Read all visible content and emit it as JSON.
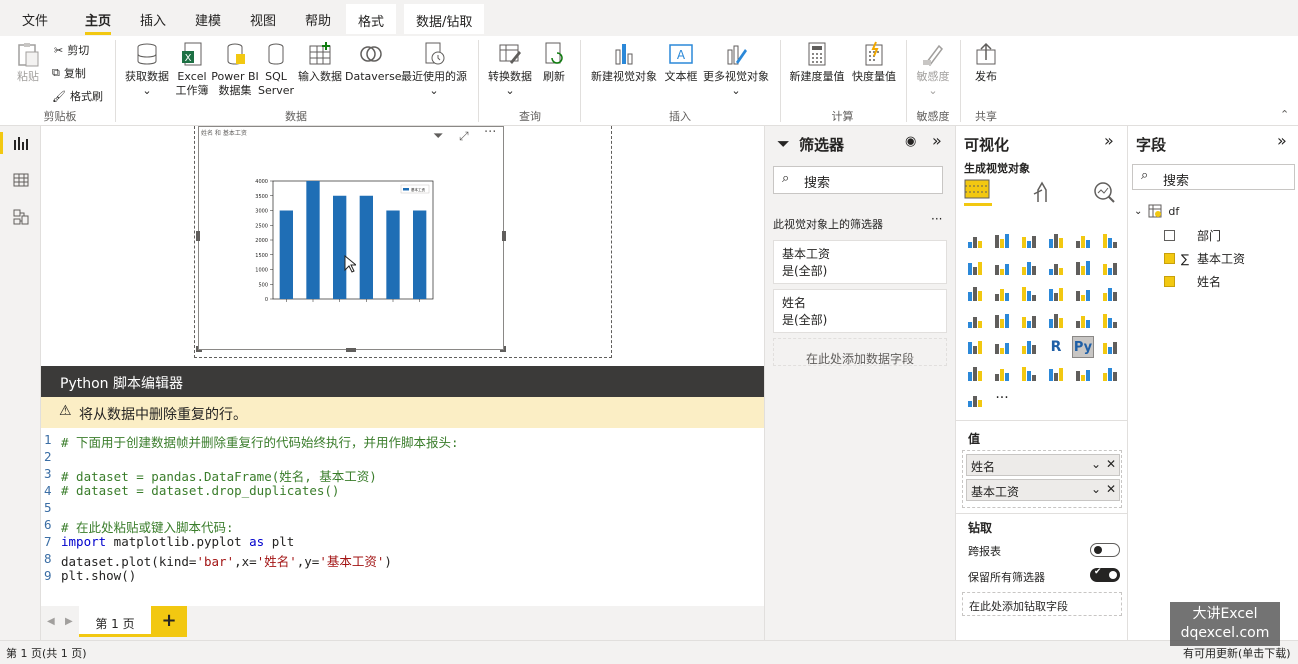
{
  "menu": {
    "items": [
      "文件",
      "主页",
      "插入",
      "建模",
      "视图",
      "帮助"
    ],
    "context_tabs": [
      "格式",
      "数据/钻取"
    ]
  },
  "ribbon": {
    "clipboard": {
      "paste": "粘贴",
      "cut": "剪切",
      "copy": "复制",
      "format_painter": "格式刷",
      "label": "剪贴板"
    },
    "data": {
      "get_data": "获取数据",
      "excel": "Excel 工作簿",
      "powerbi": "Power BI 数据集",
      "sql": "SQL Server",
      "enter": "输入数据",
      "dataverse": "Dataverse",
      "recent": "最近使用的源",
      "label": "数据"
    },
    "query": {
      "transform": "转换数据",
      "refresh": "刷新",
      "label": "查询"
    },
    "insert": {
      "new_visual": "新建视觉对象",
      "textbox": "文本框",
      "more_visuals": "更多视觉对象",
      "label": "插入"
    },
    "calc": {
      "new_measure": "新建度量值",
      "quick_measure": "快度量值",
      "label": "计算"
    },
    "sensitivity": {
      "btn": "敏感度",
      "label": "敏感度"
    },
    "share": {
      "publish": "发布",
      "label": "共享"
    }
  },
  "visual": {
    "caption": "姓名 和 基本工资",
    "legend": "基本工资"
  },
  "chart_data": {
    "type": "bar",
    "categories": [
      "",
      "",
      "",
      "",
      "",
      ""
    ],
    "values": [
      3000,
      4000,
      3500,
      3500,
      3000,
      3000
    ],
    "ylim": [
      0,
      4000
    ],
    "y_ticks": [
      "0",
      "500",
      "1000",
      "1500",
      "2000",
      "2500",
      "3000",
      "3500",
      "4000"
    ],
    "legend_position": "top-right",
    "color": "#1f6eb5"
  },
  "editor": {
    "title": "Python 脚本编辑器",
    "warning": "将从数据中删除重复的行。",
    "lines": [
      {
        "n": "1",
        "t": "# 下面用于创建数据帧并删除重复行的代码始终执行，并用作脚本报头:",
        "cls": "cm"
      },
      {
        "n": "2",
        "t": "",
        "cls": ""
      },
      {
        "n": "3",
        "t": "# dataset = pandas.DataFrame(姓名, 基本工资)",
        "cls": "cm"
      },
      {
        "n": "4",
        "t": "# dataset = dataset.drop_duplicates()",
        "cls": "cm"
      },
      {
        "n": "5",
        "t": "",
        "cls": ""
      },
      {
        "n": "6",
        "t": "# 在此处粘贴或键入脚本代码:",
        "cls": "cm"
      },
      {
        "n": "7",
        "t": "",
        "cls": "import"
      },
      {
        "n": "8",
        "t": "",
        "cls": "plot"
      },
      {
        "n": "9",
        "t": "plt.show()",
        "cls": ""
      }
    ],
    "line7": {
      "kw1": "import",
      "mid": " matplotlib.pyplot ",
      "kw2": "as",
      "end": " plt"
    },
    "line8": {
      "a": "dataset.plot(kind=",
      "s1": "'bar'",
      "b": ",x=",
      "s2": "'姓名'",
      "c": ",y=",
      "s3": "'基本工资'",
      "d": ")"
    }
  },
  "page_tabs": {
    "tab": "第 1 页",
    "add": "+"
  },
  "status": {
    "left": "第 1 页(共 1 页)",
    "right": "有可用更新(单击下载)"
  },
  "filters": {
    "title": "筛选器",
    "search_placeholder": "搜索",
    "section": "此视觉对象上的筛选器",
    "cards": [
      {
        "name": "基本工资",
        "value": "是(全部)"
      },
      {
        "name": "姓名",
        "value": "是(全部)"
      }
    ],
    "add_field": "在此处添加数据字段"
  },
  "viz": {
    "title": "可视化",
    "subtitle": "生成视觉对象",
    "values_label": "值",
    "wells": [
      "姓名",
      "基本工资"
    ],
    "drill_label": "钻取",
    "cross_report": "跨报表",
    "keep_filters": "保留所有筛选器",
    "add_drill": "在此处添加钻取字段",
    "r_label": "R",
    "py_label": "Py",
    "more": "···"
  },
  "fields": {
    "title": "字段",
    "search_placeholder": "搜索",
    "table": "df",
    "items": [
      {
        "name": "部门",
        "checked": false,
        "sigma": false
      },
      {
        "name": "基本工资",
        "checked": true,
        "sigma": true
      },
      {
        "name": "姓名",
        "checked": true,
        "sigma": false
      }
    ]
  },
  "watermark": {
    "line1": "大讲Excel",
    "line2": "dqexcel.com"
  },
  "colors": {
    "accent": "#f2c811",
    "bar": "#1f6eb5",
    "editor_header": "#3b3a39",
    "warning_bg": "#fbeec5"
  }
}
